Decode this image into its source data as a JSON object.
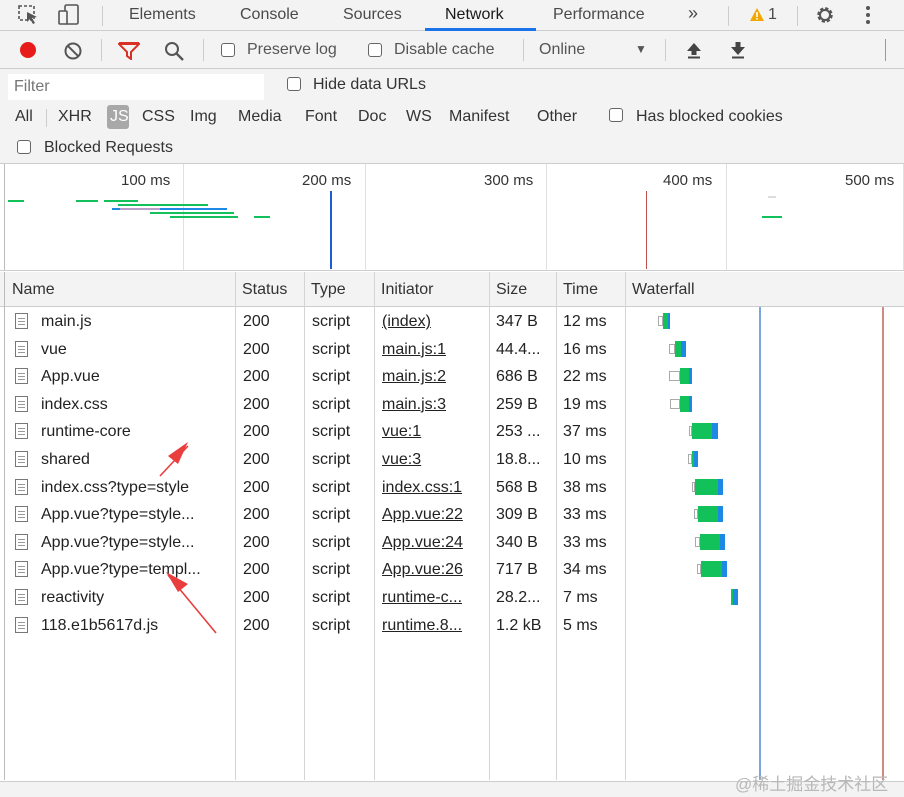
{
  "tabs": {
    "elements": "Elements",
    "console": "Console",
    "sources": "Sources",
    "network": "Network",
    "performance": "Performance",
    "more": "»",
    "warning_count": "1"
  },
  "toolbar": {
    "preserve_log": "Preserve log",
    "disable_cache": "Disable cache",
    "throttle": "Online",
    "throttle_caret": "▼"
  },
  "filter": {
    "placeholder": "Filter",
    "hide_data_urls": "Hide data URLs",
    "types": [
      "All",
      "XHR",
      "JS",
      "CSS",
      "Img",
      "Media",
      "Font",
      "Doc",
      "WS",
      "Manifest",
      "Other"
    ],
    "has_blocked_cookies": "Has blocked cookies",
    "blocked_requests": "Blocked Requests",
    "active_type": "JS"
  },
  "overview": {
    "ticks": [
      "100 ms",
      "200 ms",
      "300 ms",
      "400 ms",
      "500 ms"
    ]
  },
  "table": {
    "headers": [
      "Name",
      "Status",
      "Type",
      "Initiator",
      "Size",
      "Time",
      "Waterfall"
    ],
    "rows": [
      {
        "name": "main.js",
        "status": "200",
        "type": "script",
        "initiator": "(index)",
        "size": "347 B",
        "time": "12 ms"
      },
      {
        "name": "vue",
        "status": "200",
        "type": "script",
        "initiator": "main.js:1",
        "size": "44.4...",
        "time": "16 ms"
      },
      {
        "name": "App.vue",
        "status": "200",
        "type": "script",
        "initiator": "main.js:2",
        "size": "686 B",
        "time": "22 ms"
      },
      {
        "name": "index.css",
        "status": "200",
        "type": "script",
        "initiator": "main.js:3",
        "size": "259 B",
        "time": "19 ms"
      },
      {
        "name": "runtime-core",
        "status": "200",
        "type": "script",
        "initiator": "vue:1",
        "size": "253 ...",
        "time": "37 ms"
      },
      {
        "name": "shared",
        "status": "200",
        "type": "script",
        "initiator": "vue:3",
        "size": "18.8...",
        "time": "10 ms"
      },
      {
        "name": "index.css?type=style",
        "status": "200",
        "type": "script",
        "initiator": "index.css:1",
        "size": "568 B",
        "time": "38 ms"
      },
      {
        "name": "App.vue?type=style...",
        "status": "200",
        "type": "script",
        "initiator": "App.vue:22",
        "size": "309 B",
        "time": "33 ms"
      },
      {
        "name": "App.vue?type=style...",
        "status": "200",
        "type": "script",
        "initiator": "App.vue:24",
        "size": "340 B",
        "time": "33 ms"
      },
      {
        "name": "App.vue?type=templ...",
        "status": "200",
        "type": "script",
        "initiator": "App.vue:26",
        "size": "717 B",
        "time": "34 ms"
      },
      {
        "name": "reactivity",
        "status": "200",
        "type": "script",
        "initiator": "runtime-c...",
        "size": "28.2...",
        "time": "7 ms"
      },
      {
        "name": "118.e1b5617d.js",
        "status": "200",
        "type": "script",
        "initiator": "runtime.8...",
        "size": "1.2 kB",
        "time": "5 ms"
      }
    ]
  },
  "watermark": "@稀土掘金技术社区",
  "colors": {
    "accent": "#1a73e8",
    "record": "#e81b1b",
    "filter_icon": "#d93025",
    "waterfall_green": "#12c15a",
    "waterfall_blue": "#1e88e5",
    "load_line": "#c0504d",
    "annotation_arrow": "#e83e3e"
  }
}
